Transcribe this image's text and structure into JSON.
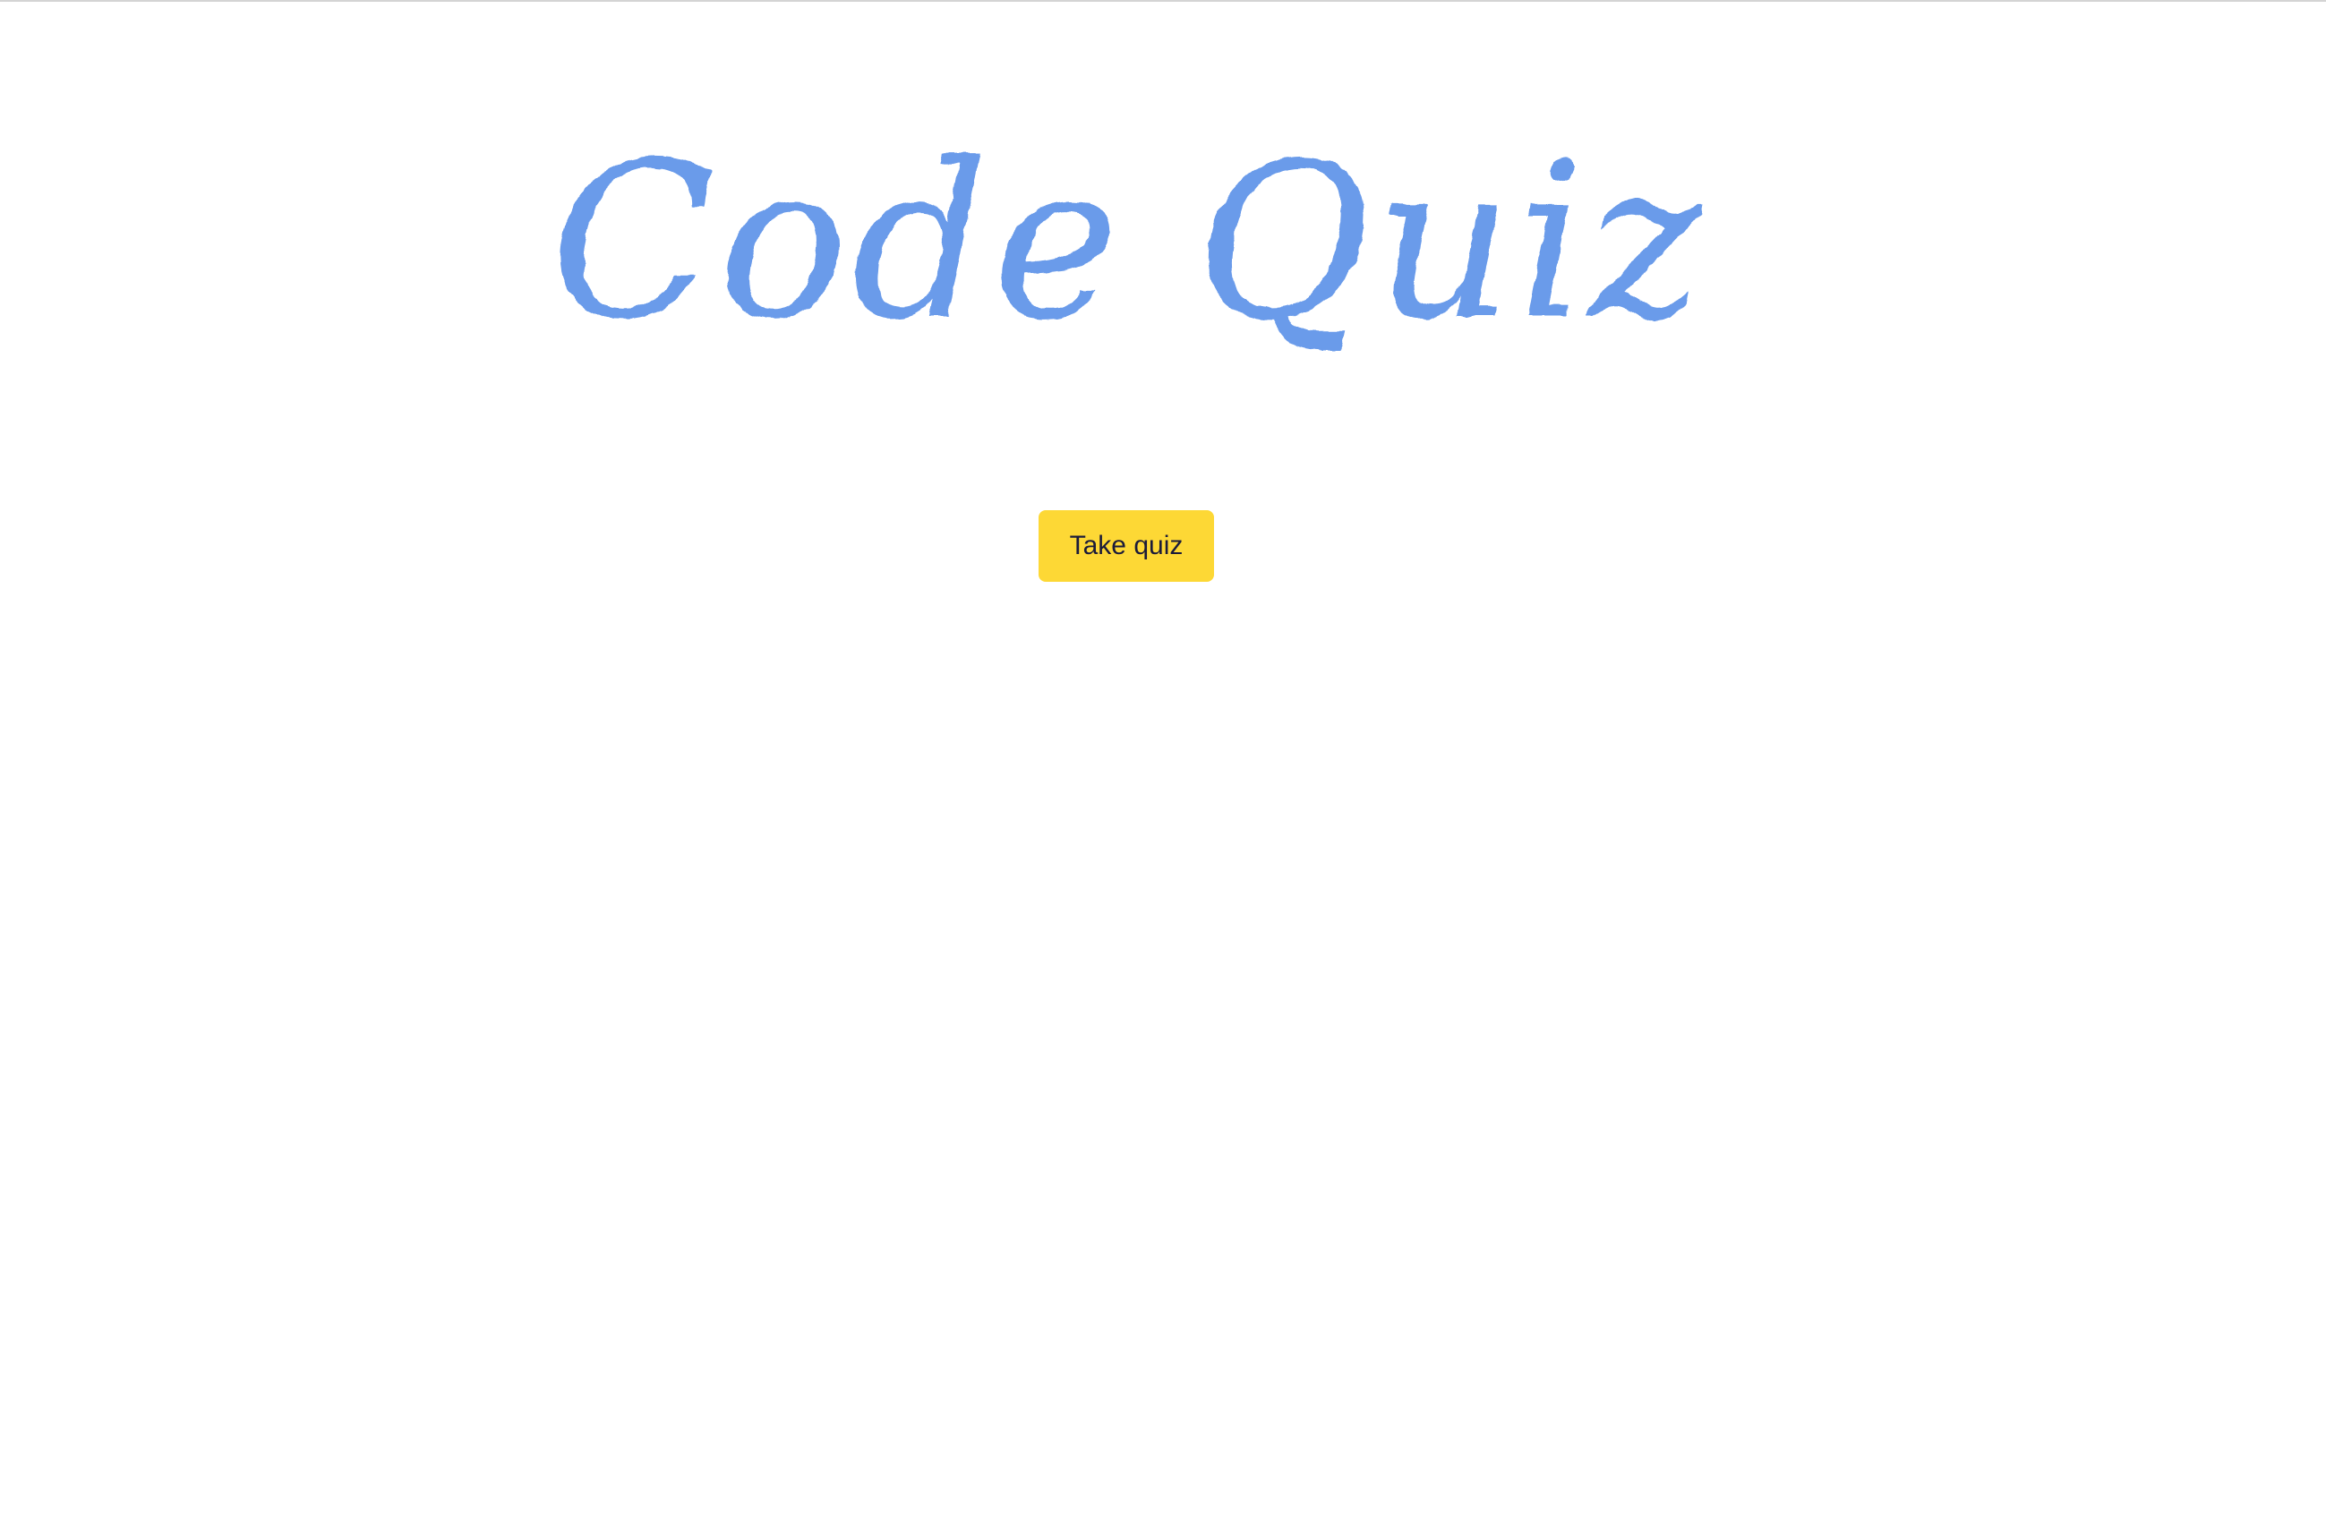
{
  "header": {
    "title": "Code Quiz"
  },
  "main": {
    "start_button_label": "Take quiz"
  },
  "colors": {
    "title": "#6a9bea",
    "button_bg": "#fdd835",
    "button_text": "#1b1b3a",
    "background": "#ffffff"
  }
}
